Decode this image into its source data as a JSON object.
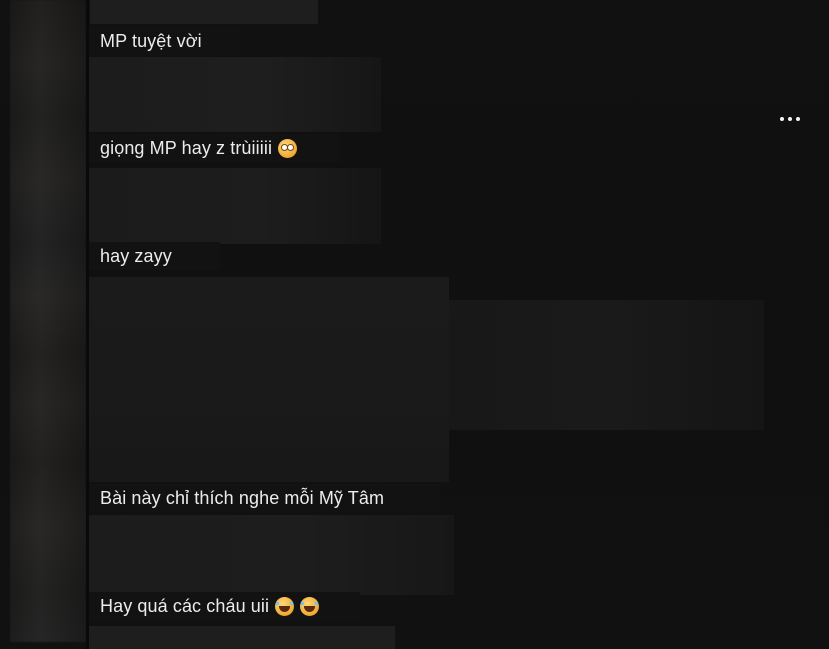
{
  "comments": [
    {
      "text": "MP tuyệt vời",
      "emoji": ""
    },
    {
      "text": "giọng MP hay z trùiiiii",
      "emoji": "flushed-face-icon"
    },
    {
      "text": "hay zayy",
      "emoji": ""
    },
    {
      "text": "Bài này chỉ thích nghe mỗi Mỹ Tâm",
      "emoji": ""
    },
    {
      "text": "Hay quá các cháu uii",
      "emoji": "laughing-face-icon"
    }
  ],
  "menu": {
    "icon": "more-options-icon"
  },
  "colors": {
    "background": "#111111",
    "caption_bg": "#121212",
    "text": "#ececec"
  }
}
